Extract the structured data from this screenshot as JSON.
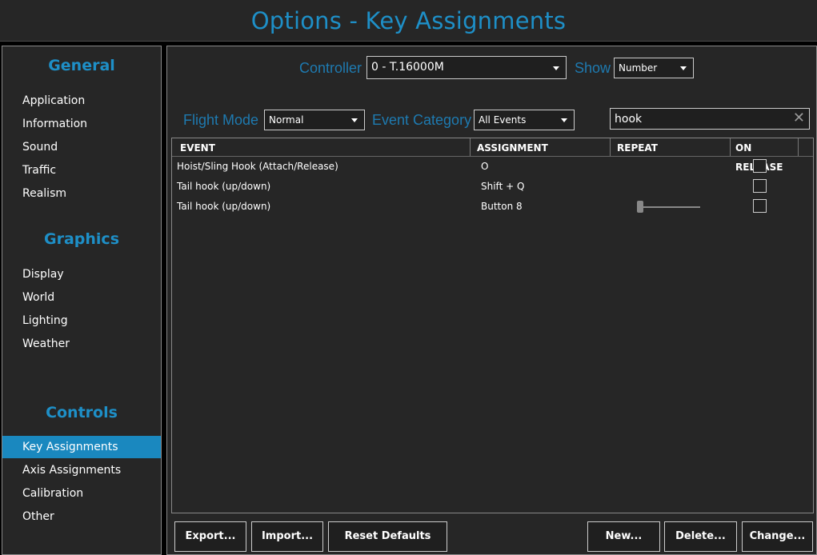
{
  "window": {
    "title": "Options - Key Assignments"
  },
  "sidebar": {
    "general": {
      "title": "General",
      "items": [
        "Application",
        "Information",
        "Sound",
        "Traffic",
        "Realism"
      ]
    },
    "graphics": {
      "title": "Graphics",
      "items": [
        "Display",
        "World",
        "Lighting",
        "Weather"
      ]
    },
    "controls": {
      "title": "Controls",
      "items": [
        "Key Assignments",
        "Axis Assignments",
        "Calibration",
        "Other"
      ],
      "active": "Key Assignments"
    }
  },
  "filters": {
    "controller_label": "Controller",
    "controller_value": "0 - T.16000M",
    "show_label": "Show",
    "show_value": "Number",
    "flight_mode_label": "Flight Mode",
    "flight_mode_value": "Normal",
    "event_category_label": "Event Category",
    "event_category_value": "All Events",
    "search_value": "hook",
    "clear_glyph": "✕"
  },
  "table": {
    "headers": {
      "event": "EVENT",
      "assignment": "ASSIGNMENT",
      "repeat": "REPEAT",
      "on_release": "ON RELEASE"
    },
    "rows": [
      {
        "event": "Hoist/Sling Hook (Attach/Release)",
        "assignment": "O",
        "repeat_slider": false,
        "on_release": false
      },
      {
        "event": "Tail hook (up/down)",
        "assignment": "Shift + Q",
        "repeat_slider": false,
        "on_release": false
      },
      {
        "event": "Tail hook (up/down)",
        "assignment": "Button 8",
        "repeat_slider": true,
        "repeat_value": 0,
        "on_release": false
      }
    ]
  },
  "buttons": {
    "export": "Export...",
    "import": "Import...",
    "reset": "Reset Defaults",
    "new": "New...",
    "delete": "Delete...",
    "change": "Change..."
  },
  "colors": {
    "accent": "#1e8fc7",
    "active_bg": "#1a88bf",
    "panel_bg": "#262626"
  }
}
